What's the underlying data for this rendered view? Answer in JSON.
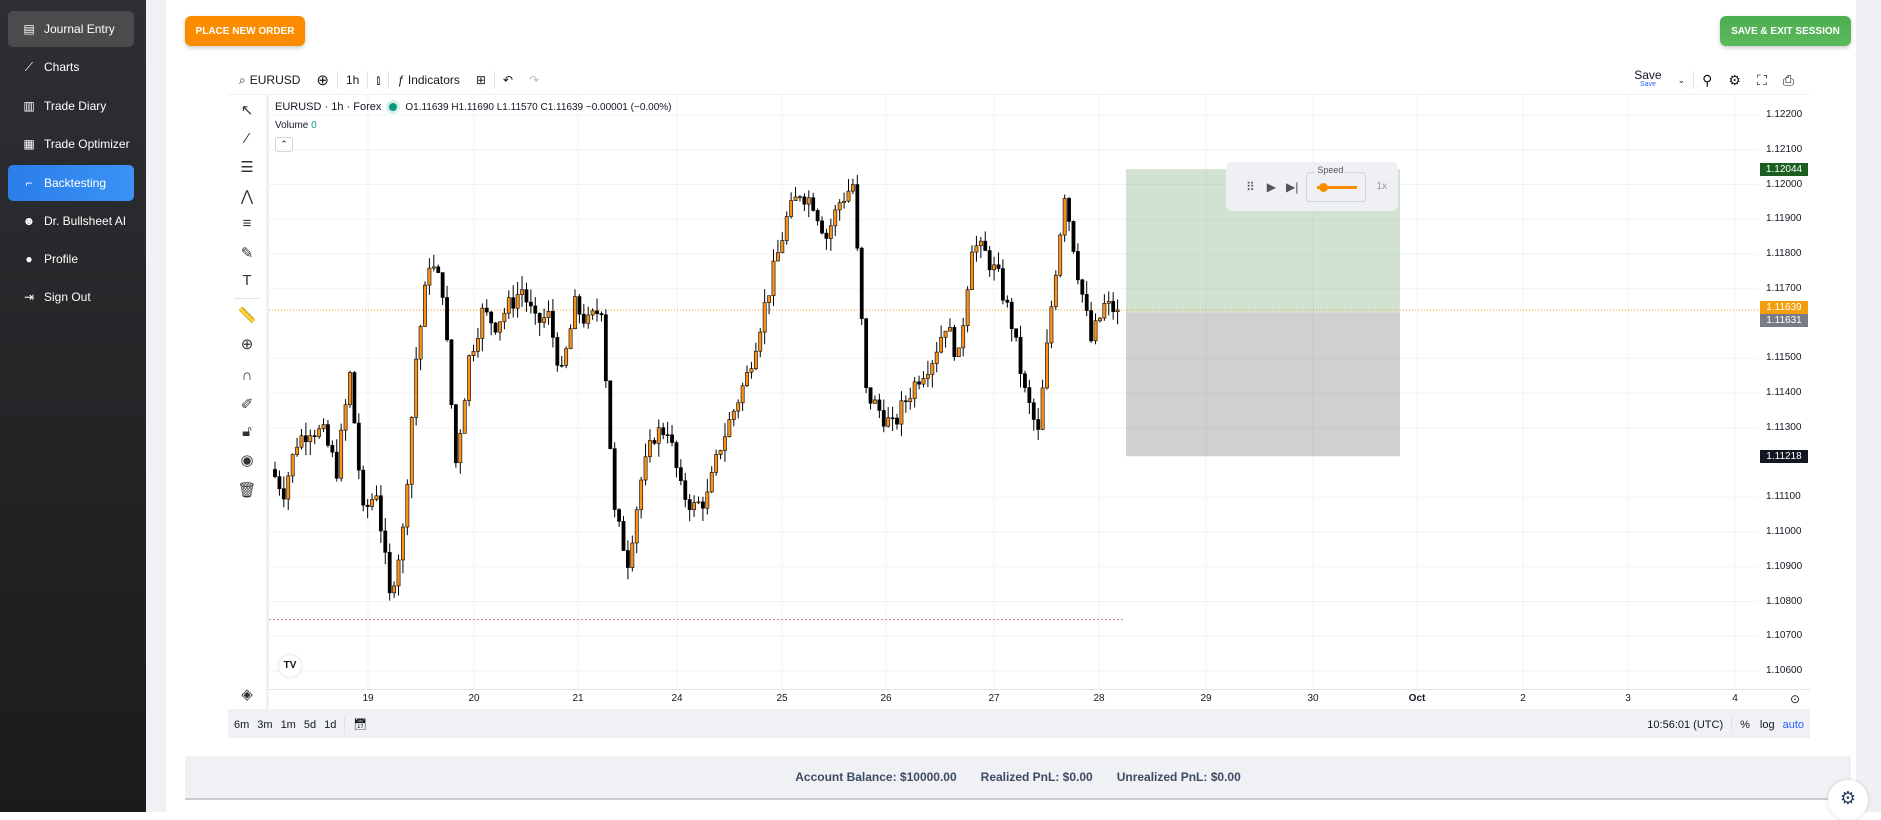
{
  "sidebar": {
    "items": [
      {
        "label": "Journal Entry",
        "icon": "journal-icon"
      },
      {
        "label": "Charts",
        "icon": "charts-icon"
      },
      {
        "label": "Trade Diary",
        "icon": "book-icon"
      },
      {
        "label": "Trade Optimizer",
        "icon": "calculator-icon"
      },
      {
        "label": "Backtesting",
        "icon": "backtest-icon"
      },
      {
        "label": "Dr. Bullsheet AI",
        "icon": "robot-icon"
      },
      {
        "label": "Profile",
        "icon": "user-icon"
      },
      {
        "label": "Sign Out",
        "icon": "sign-out-icon"
      }
    ],
    "active": "Backtesting"
  },
  "header": {
    "place_order": "PLACE NEW ORDER",
    "save_exit": "SAVE & EXIT SESSION",
    "place_color": "#fb8c00",
    "save_color": "#4caf50"
  },
  "toolbar": {
    "symbol": "EURUSD",
    "interval": "1h",
    "indicators": "Indicators",
    "save": "Save",
    "save_sub": "Save"
  },
  "legend": {
    "title": "EURUSD · 1h · Forex",
    "ohlc": "O1.11639 H1.11690 L1.11570 C1.11639 −0.00001 (−0.00%)",
    "volume_label": "Volume",
    "volume_value": "0"
  },
  "player": {
    "speed_label": "Speed",
    "speed_value": "1x",
    "speed_fraction": 0.15
  },
  "bottom": {
    "ranges": [
      "6m",
      "3m",
      "1m",
      "5d",
      "1d"
    ],
    "time": "10:56:01 (UTC)",
    "pct": "%",
    "log": "log",
    "auto": "auto"
  },
  "footer": {
    "balance": "Account Balance: $10000.00",
    "realized": "Realized PnL: $0.00",
    "unrealized": "Unrealized PnL: $0.00"
  },
  "chart_data": {
    "type": "candlestick",
    "symbol": "EURUSD",
    "interval": "1h",
    "y_ticks": [
      "1.12200",
      "1.12100",
      "1.12000",
      "1.11900",
      "1.11800",
      "1.11700",
      "1.11500",
      "1.11400",
      "1.11300",
      "1.11100",
      "1.11000",
      "1.10900",
      "1.10800",
      "1.10700",
      "1.10600"
    ],
    "ylim": [
      1.1053,
      1.1227
    ],
    "x_ticks": [
      "19",
      "20",
      "21",
      "24",
      "25",
      "26",
      "27",
      "28",
      "29",
      "30",
      "Oct",
      "2",
      "3",
      "4"
    ],
    "closes": [
      1.1118,
      1.1112,
      1.1126,
      1.113,
      1.1128,
      1.1118,
      1.1145,
      1.1105,
      1.1112,
      1.1081,
      1.11,
      1.115,
      1.1178,
      1.117,
      1.112,
      1.115,
      1.1163,
      1.116,
      1.1165,
      1.117,
      1.116,
      1.1162,
      1.1145,
      1.1165,
      1.116,
      1.1165,
      1.1105,
      1.1092,
      1.1115,
      1.1128,
      1.113,
      1.1112,
      1.1107,
      1.111,
      1.1125,
      1.1135,
      1.1145,
      1.116,
      1.1175,
      1.119,
      1.1198,
      1.1195,
      1.1185,
      1.1195,
      1.12,
      1.114,
      1.1135,
      1.113,
      1.1138,
      1.1145,
      1.115,
      1.116,
      1.115,
      1.1183,
      1.118,
      1.1173,
      1.116,
      1.114,
      1.1128,
      1.1165,
      1.1198,
      1.1175,
      1.1155,
      1.1165,
      1.11639
    ],
    "up_color": "#f7931a",
    "down_color": "#000000",
    "current_price": "1.11639",
    "current_color": "#f59e0b",
    "position": {
      "take_profit": "1.12044",
      "entry": "1.11631",
      "stop_loss": "1.11218",
      "tp_color": "#1b5e20",
      "entry_color": "#787b86",
      "sl_color": "#131722"
    },
    "grid": true
  }
}
